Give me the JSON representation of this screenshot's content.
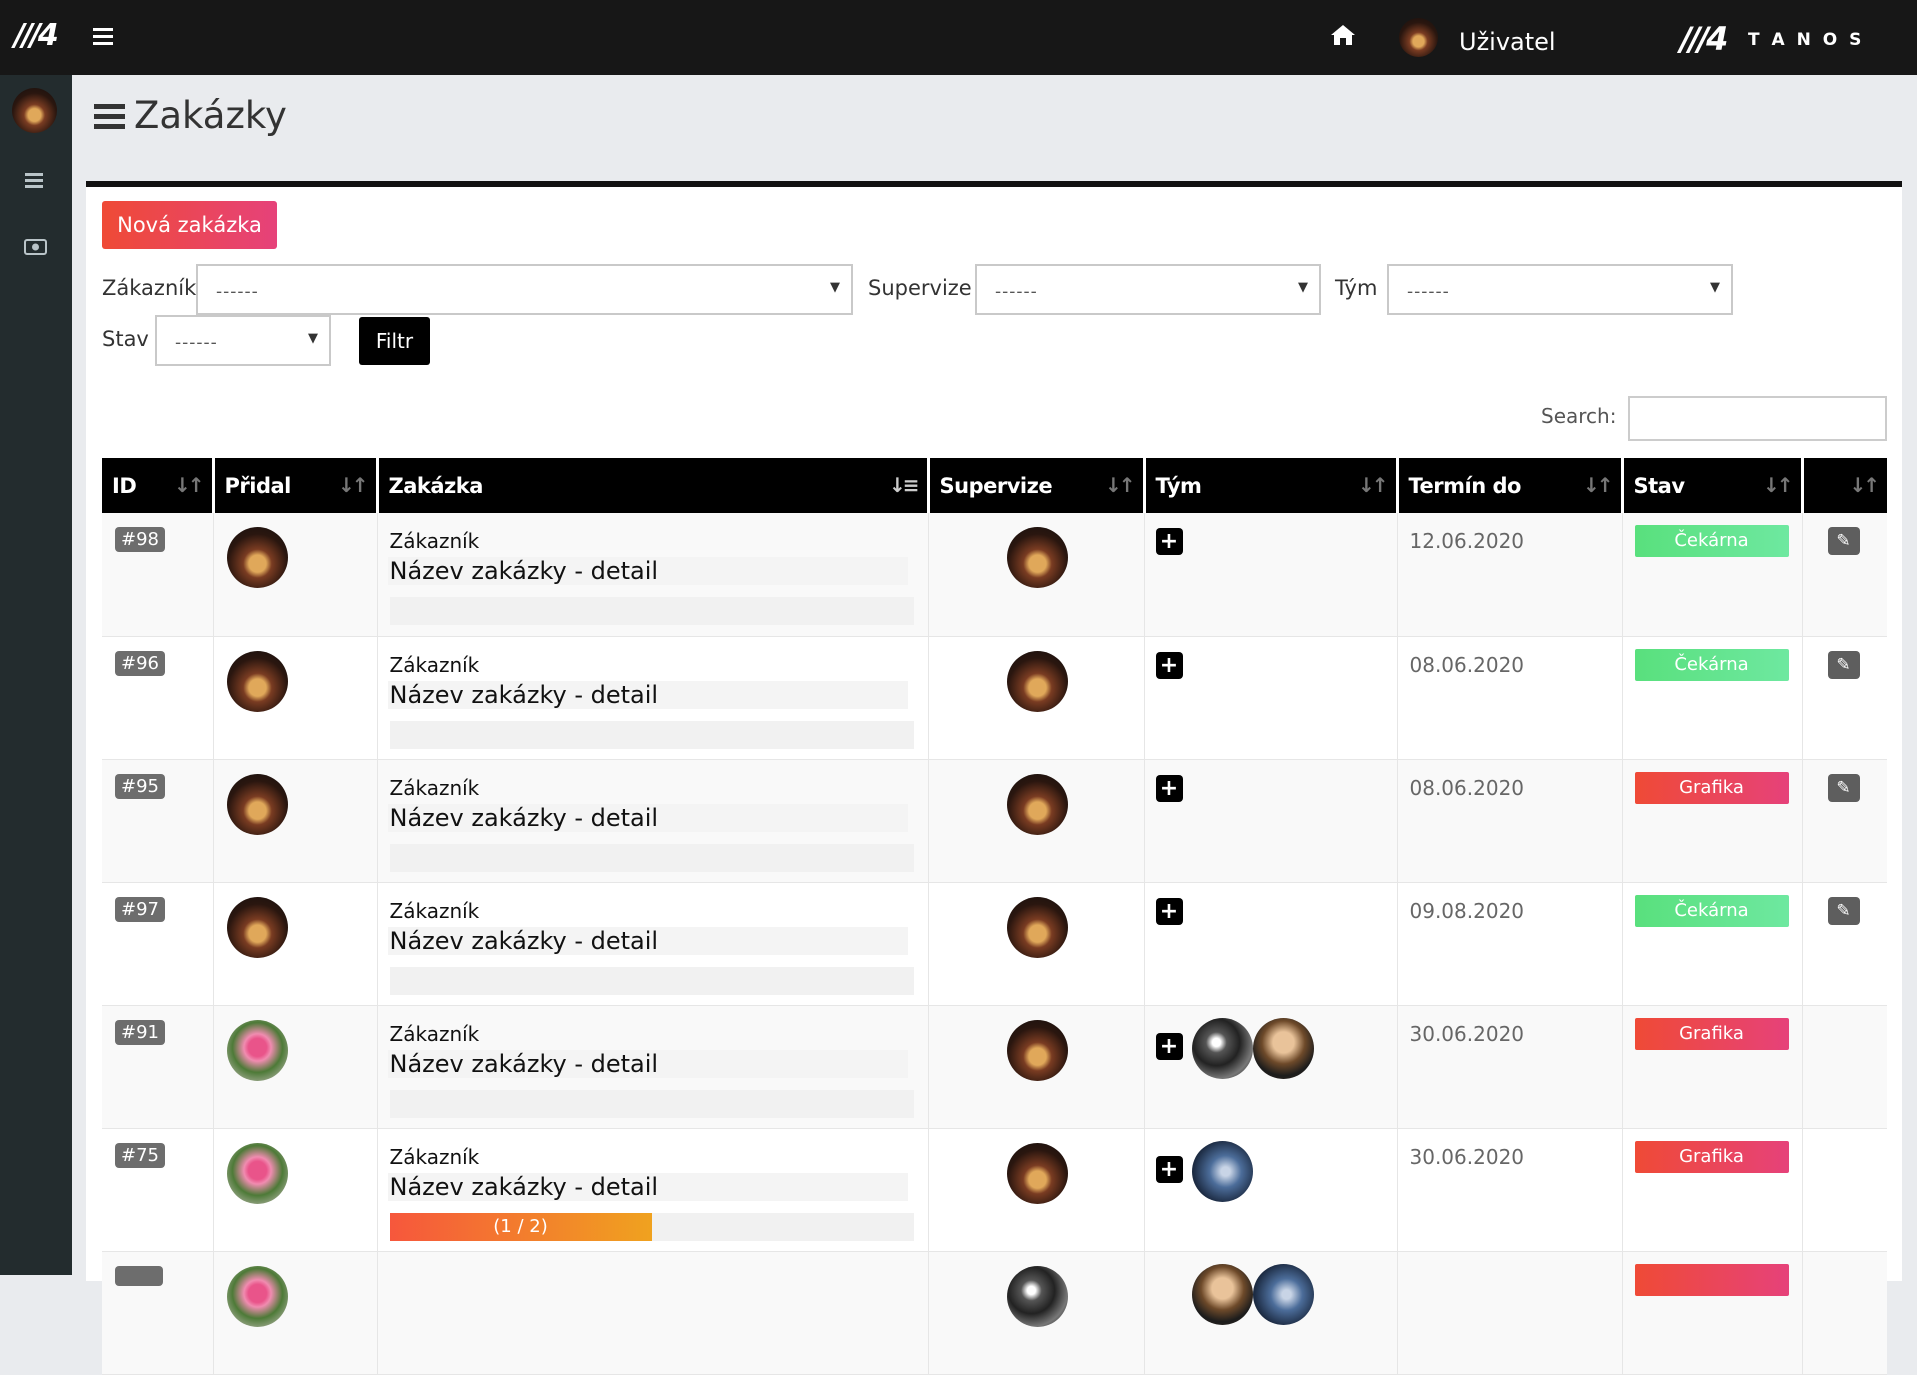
{
  "topbar": {
    "logo_left": "///4",
    "user_name": "Uživatel",
    "brand_logo": "///4",
    "brand_name": "T A N O S"
  },
  "page": {
    "title": "Zakázky"
  },
  "actions": {
    "new_label": "Nová zakázka",
    "filter_label": "Filtr"
  },
  "filters": {
    "customer_label": "Zákazník",
    "customer_value": "------",
    "supervision_label": "Supervize",
    "supervision_value": "------",
    "team_label": "Tým",
    "team_value": "------",
    "state_label": "Stav",
    "state_value": "------"
  },
  "search": {
    "label": "Search:"
  },
  "table": {
    "columns": [
      "ID",
      "Přidal",
      "Zakázka",
      "Supervize",
      "Tým",
      "Termín do",
      "Stav",
      ""
    ],
    "rows": [
      {
        "id": "#98",
        "customer": "Zákazník",
        "title": "Název zakázky - detail",
        "date": "12.06.2020",
        "status": "Čekárna",
        "progress": ""
      },
      {
        "id": "#96",
        "customer": "Zákazník",
        "title": "Název zakázky - detail",
        "date": "08.06.2020",
        "status": "Čekárna",
        "progress": ""
      },
      {
        "id": "#95",
        "customer": "Zákazník",
        "title": "Název zakázky - detail",
        "date": "08.06.2020",
        "status": "Grafika",
        "progress": ""
      },
      {
        "id": "#97",
        "customer": "Zákazník",
        "title": "Název zakázky - detail",
        "date": "09.08.2020",
        "status": "Čekárna",
        "progress": ""
      },
      {
        "id": "#91",
        "customer": "Zákazník",
        "title": "Název zakázky - detail",
        "date": "30.06.2020",
        "status": "Grafika",
        "progress": ""
      },
      {
        "id": "#75",
        "customer": "Zákazník",
        "title": "Název zakázky - detail",
        "date": "30.06.2020",
        "status": "Grafika",
        "progress": "(1 / 2)"
      }
    ]
  },
  "colors": {
    "cekarna": "#5fe08c",
    "grafika": "#ee4257",
    "topbar": "#171717",
    "sidebar": "#232c2e"
  },
  "icons": {
    "home": "home-icon",
    "menu": "hamburger-icon",
    "money": "money-icon",
    "edit": "edit-icon",
    "plus": "plus-icon",
    "sort": "sort-icon"
  }
}
